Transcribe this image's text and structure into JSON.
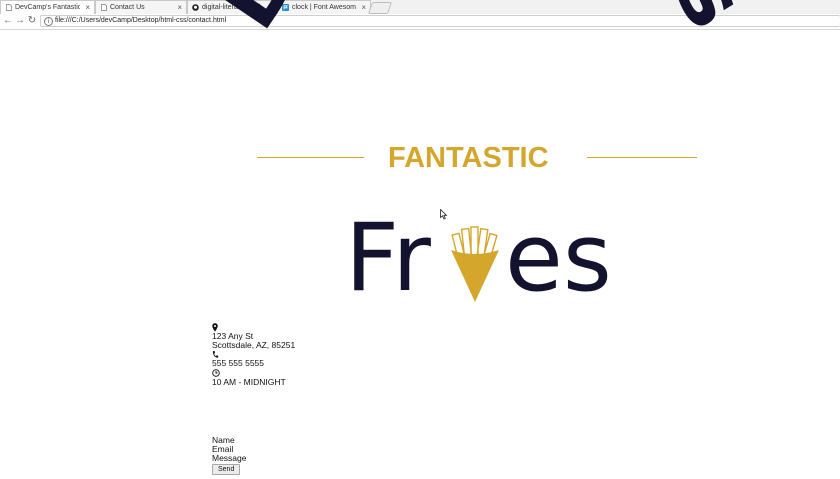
{
  "browser": {
    "tabs": [
      {
        "title": "DevCamp's Fantastic Fries",
        "active": true,
        "favicon": "page-icon"
      },
      {
        "title": "Contact Us",
        "active": false,
        "favicon": "page-icon"
      },
      {
        "title": "digital-literacy-html-css",
        "active": false,
        "favicon": "github-icon"
      },
      {
        "title": "clock | Font Awesome",
        "active": false,
        "favicon": "font-awesome-icon"
      }
    ],
    "url": "file:///C:/Users/devCamp/Desktop/html-css/contact.html"
  },
  "logo": {
    "arc_text": "DevCamp's",
    "tagline": "FANTASTIC",
    "word_part1": "Fr",
    "word_part2": "es",
    "accent_color": "#d4a72c",
    "dark_color": "#14132f"
  },
  "contact": {
    "address_line1": "123 Any St",
    "address_line2": "Scottsdale, AZ, 85251",
    "phone": "555 555 5555",
    "hours": "10 AM - MIDNIGHT"
  },
  "form": {
    "name_label": "Name",
    "email_label": "Email",
    "message_label": "Message",
    "send_label": "Send"
  }
}
